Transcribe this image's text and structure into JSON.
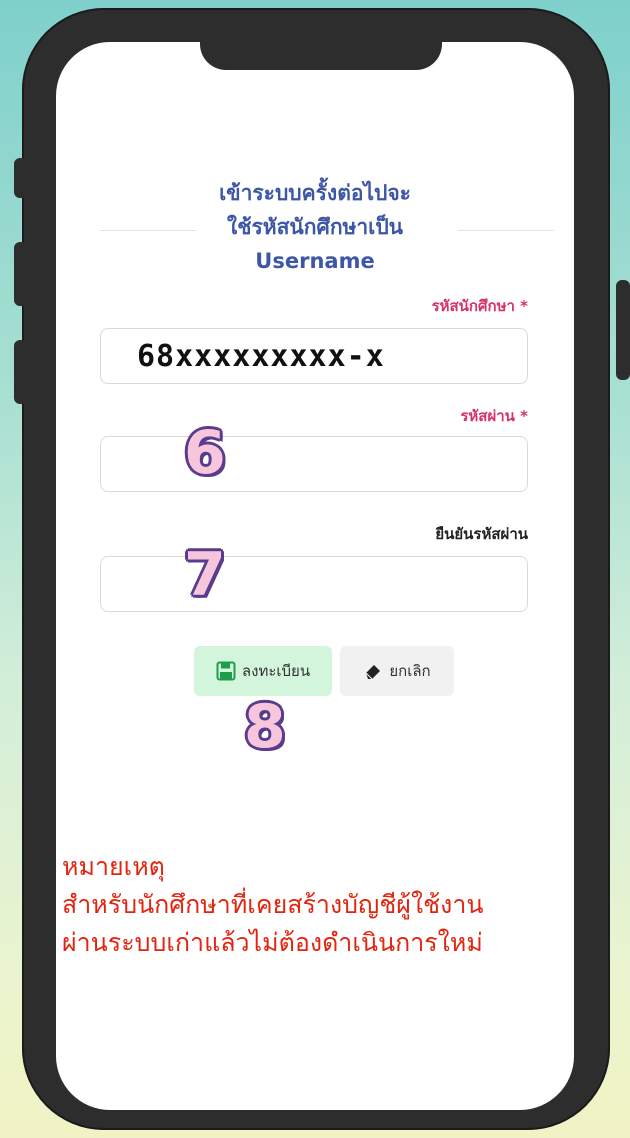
{
  "form": {
    "headline_line1": "เข้าระบบครั้งต่อไปจะ",
    "headline_line2": "ใช้รหัสนักศึกษาเป็น",
    "headline_line3": "Username",
    "student_id_label": "รหัสนักศึกษา *",
    "student_id_value": "68xxxxxxxxx-x",
    "password_label": "รหัสผ่าน *",
    "password_value": "",
    "confirm_label": "ยืนยันรหัสผ่าน",
    "confirm_value": ""
  },
  "buttons": {
    "register_label": "ลงทะเบียน",
    "cancel_label": "ยกเลิก"
  },
  "steps": {
    "password_step": "6",
    "confirm_step": "7",
    "register_step": "8"
  },
  "note": {
    "line1": "หมายเหตุ",
    "line2": "สำหรับนักศึกษาที่เคยสร้างบัญชีผู้ใช้งาน",
    "line3": "ผ่านระบบเก่าแล้วไม่ต้องดำเนินการใหม่"
  },
  "colors": {
    "headline": "#3d56a6",
    "required_label": "#d6336c",
    "note_text": "#e3250f",
    "register_bg": "#d3f5dc",
    "cancel_bg": "#f1f1f1"
  }
}
